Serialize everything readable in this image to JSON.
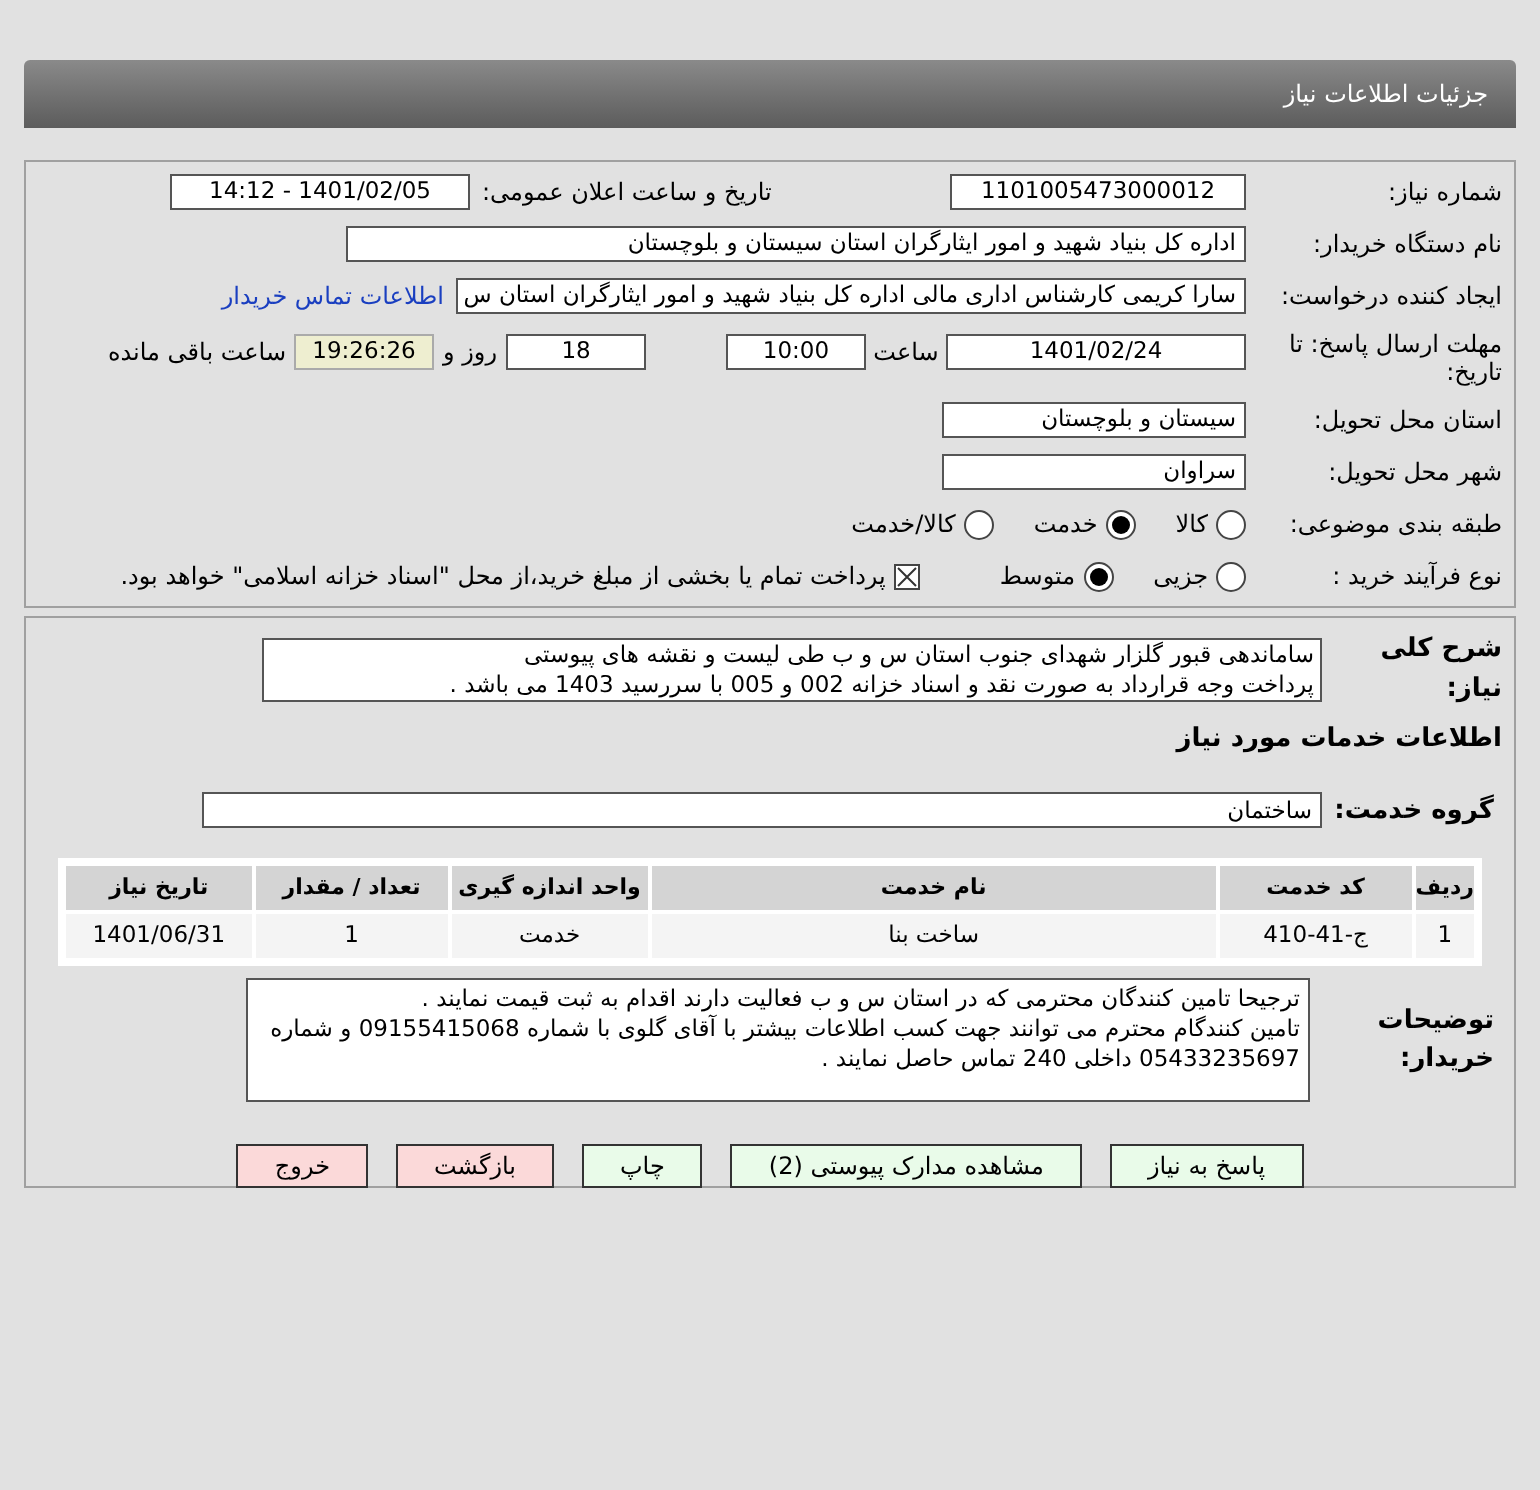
{
  "header": {
    "title": "جزئیات اطلاعات نیاز"
  },
  "need_number": {
    "label": "شماره نیاز:",
    "value": "1101005473000012"
  },
  "announce": {
    "label": "تاریخ و ساعت اعلان عمومی:",
    "value": "1401/02/05 - 14:12"
  },
  "buyer_org": {
    "label": "نام دستگاه خریدار:",
    "value": "اداره کل بنیاد شهید و امور ایثارگران استان سیستان و بلوچستان"
  },
  "requester": {
    "label": "ایجاد کننده درخواست:",
    "value": "سارا کریمی کارشناس اداری مالی اداره کل بنیاد شهید و امور ایثارگران استان س",
    "link": "اطلاعات تماس خریدار"
  },
  "deadline": {
    "label": "مهلت ارسال پاسخ: تا تاریخ:",
    "date": "1401/02/24",
    "time_label": "ساعت",
    "time": "10:00",
    "days": "18",
    "days_label": "روز و",
    "remaining": "19:26:26",
    "remaining_label": "ساعت باقی مانده"
  },
  "province": {
    "label": "استان محل تحویل:",
    "value": "سیستان و بلوچستان"
  },
  "city": {
    "label": "شهر محل تحویل:",
    "value": "سراوان"
  },
  "category": {
    "label": "طبقه بندی موضوعی:",
    "options": [
      {
        "label": "کالا",
        "selected": false
      },
      {
        "label": "خدمت",
        "selected": true
      },
      {
        "label": "کالا/خدمت",
        "selected": false
      }
    ]
  },
  "process": {
    "label": "نوع فرآیند خرید :",
    "options": [
      {
        "label": "جزیی",
        "selected": false
      },
      {
        "label": "متوسط",
        "selected": true
      }
    ],
    "payment": {
      "checked": true,
      "label": "پرداخت تمام یا بخشی از مبلغ خرید،از محل \"اسناد خزانه اسلامی\" خواهد بود."
    }
  },
  "description": {
    "label": "شرح کلی نیاز:",
    "lines": [
      "ساماندهی قبور گلزار شهدای جنوب استان س و ب طی لیست و نقشه های پیوستی",
      "پرداخت وجه قرارداد به صورت نقد و اسناد خزانه 002 و 005 با سررسید 1403 می باشد ."
    ]
  },
  "services_title": "اطلاعات خدمات مورد نیاز",
  "service_group": {
    "label": "گروه خدمت:",
    "value": "ساختمان"
  },
  "table": {
    "columns": [
      "ردیف",
      "کد خدمت",
      "نام خدمت",
      "واحد اندازه گیری",
      "تعداد / مقدار",
      "تاریخ نیاز"
    ],
    "rows": [
      [
        "1",
        "ج-41-410",
        "ساخت بنا",
        "خدمت",
        "1",
        "1401/06/31"
      ]
    ]
  },
  "buyer_notes": {
    "label": "توضیحات خریدار:",
    "lines": [
      "ترجیحا تامین کنندگان محترمی که در استان س و ب فعالیت دارند اقدام به ثبت قیمت نمایند .",
      "تامین کنندگام محترم می توانند جهت کسب اطلاعات بیشتر با آقای گلوی با شماره 09155415068 و شماره 05433235697 داخلی 240 تماس حاصل نمایند ."
    ]
  },
  "buttons": [
    {
      "label": "پاسخ به نیاز",
      "kind": "green"
    },
    {
      "label": "مشاهده مدارک پیوستی (2)",
      "kind": "green"
    },
    {
      "label": "چاپ",
      "kind": "green"
    },
    {
      "label": "بازگشت",
      "kind": "pink"
    },
    {
      "label": "خروج",
      "kind": "pink"
    }
  ]
}
